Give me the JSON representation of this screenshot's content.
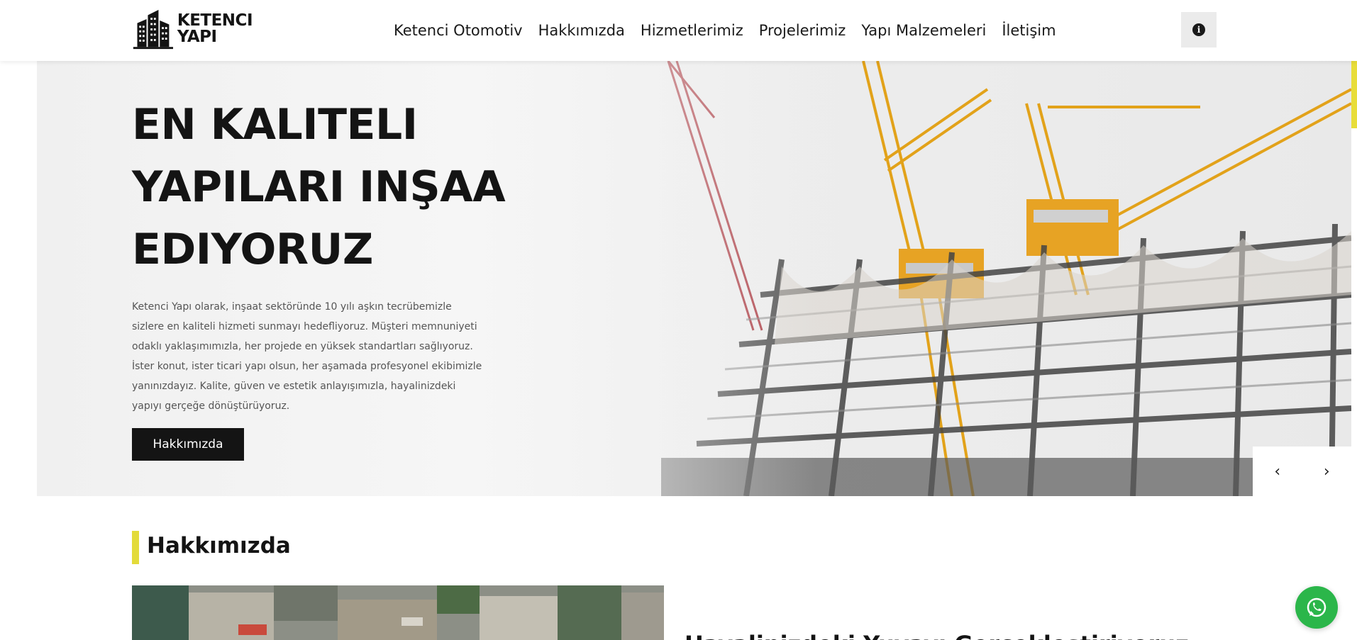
{
  "brand": {
    "line1": "KETENCI",
    "line2": "YAPI"
  },
  "nav": {
    "items": [
      {
        "label": "Ketenci Otomotiv"
      },
      {
        "label": "Hakkımızda"
      },
      {
        "label": "Hizmetlerimiz"
      },
      {
        "label": "Projelerimiz"
      },
      {
        "label": "Yapı Malzemeleri"
      },
      {
        "label": "İletişim"
      }
    ]
  },
  "header": {
    "info_icon": "info-icon"
  },
  "hero": {
    "title_lines": [
      "EN KALITELI",
      "YAPILARI INŞAA",
      "EDIYORUZ"
    ],
    "description": "Ketenci Yapı olarak, inşaat sektöründe 10 yılı aşkın tecrübemizle sizlere en kaliteli hizmeti sunmayı hedefliyoruz. Müşteri memnuniyeti odaklı yaklaşımımızla, her projede en yüksek standartları sağlıyoruz. İster konut, ister ticari yapı olsun, her aşamada profesyonel ekibimizle yanınızdayız. Kalite, güven ve estetik anlayışımızla, hayalinizdeki yapıyı gerçeğe dönüştürüyoruz.",
    "button_label": "Hakkımızda",
    "prev_icon": "‹",
    "next_icon": "›"
  },
  "about": {
    "section_title": "Hakkımızda",
    "heading": "Hayalinizdeki Yuvayı Gerçekleştiriyoruz"
  },
  "colors": {
    "accent": "#e3db3a",
    "dark": "#141414",
    "whatsapp": "#2bb64a"
  }
}
